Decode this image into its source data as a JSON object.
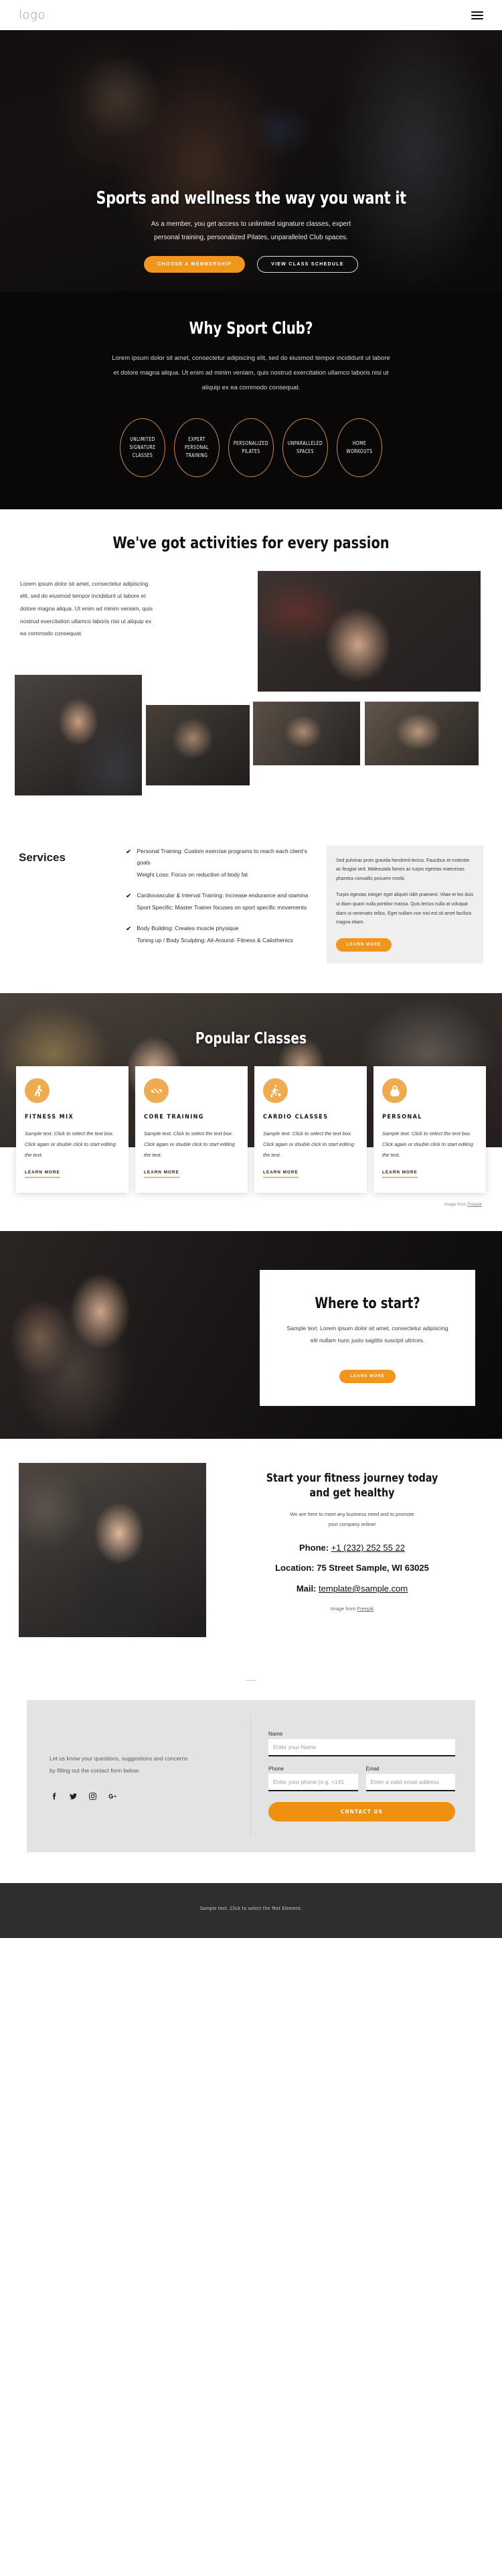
{
  "header": {
    "logo": "logo",
    "menu_icon": "hamburger-icon"
  },
  "hero": {
    "title": "Sports and wellness the way you want it",
    "subtitle_line1": "As a member, you get access to unlimited signature classes, expert",
    "subtitle_line2": "personal training, personalized Pilates, unparalleled Club spaces.",
    "primary_button": "Choose a Membership",
    "secondary_button": "View Class Schedule"
  },
  "why": {
    "title": "Why Sport Club?",
    "paragraph": "Lorem ipsum dolor sit amet, consectetur adipiscing elit, sed do eiusmod tempor incididunt ut labore et dolore magna aliqua. Ut enim ad minim veniam, quis nostrud exercitation ullamco laboris nisi ut aliquip ex ea commodo consequat.",
    "badges": [
      "Unlimited Signature Classes",
      "Expert Personal Training",
      "Personalized Pilates",
      "Unparalleled Spaces",
      "Home Workouts"
    ]
  },
  "activities": {
    "title": "We've got activities for every passion",
    "paragraph": "Lorem ipsum dolor sit amet, consectetur adipiscing elit, sed do eiusmod tempor incididunt ut labore et dolore magna aliqua. Ut enim ad minim veniam, quis nostrud exercitation ullamco laboris nisi ut aliquip ex ea commodo consequat."
  },
  "services": {
    "title": "Services",
    "items": [
      "Personal Training: Custom exercise programs to reach each client’s goals\nWeight Loss: Focus on reduction of body fat",
      "Cardiovascular & Interval Training: Increase endurance and stamina\nSport Specific: Master Trainer focuses on sport specific movements",
      "Body Building: Creates muscle physique\nToning up / Body Sculpting: All-Around- Fitness & Calisthenics"
    ],
    "aside_p1": "Sed pulvinar proin gravida hendrerit lectus. Faucibus et molestie ac feugiat sed. Malesuada fames ac turpis egestas maecenas pharetra convallis posuere morbi.",
    "aside_p2": "Turpis egestas integer eget aliquet nibh praesent. Vitae et leo duis ut diam quam nulla porttitor massa. Quis lectus nulla at volutpat diam ut venenatis tellus. Eget nullam non nisi est sit amet facilisis magna etiam.",
    "aside_button": "Learn More"
  },
  "popular": {
    "title": "Popular Classes",
    "cards": [
      {
        "icon": "stretching-icon",
        "title": "Fitness Mix",
        "text": "Sample text. Click to select the text box. Click again or double click to start editing the text.",
        "link": "Learn More"
      },
      {
        "icon": "dumbbell-icon",
        "title": "Core Training",
        "text": "Sample text. Click to select the text box. Click again or double click to start editing the text.",
        "link": "Learn More"
      },
      {
        "icon": "exercise-bike-icon",
        "title": "Cardio Classes",
        "text": "Sample text. Click to select the text box. Click again or double click to start editing the text.",
        "link": "Learn More"
      },
      {
        "icon": "kettlebell-icon",
        "title": "Personal",
        "text": "Sample text. Click to select the text box. Click again or double click to start editing the text.",
        "link": "Learn More"
      }
    ],
    "credit_prefix": "Image from ",
    "credit_link": "Freepik"
  },
  "where": {
    "title": "Where to start?",
    "text": "Sample text. Lorem ipsum dolor sit amet, consectetur adipiscing elit nullam nunc justo sagittis suscipit ultrices.",
    "button": "Learn More"
  },
  "journey": {
    "title_line1": "Start your fitness journey today",
    "title_line2": "and get healthy",
    "sub_line1": "We are here to meet any business need and to promote",
    "sub_line2": "your company online!",
    "phone_label": "Phone: ",
    "phone_value": "+1 (232) 252 55 22",
    "location_label": "Location: ",
    "location_value": "75 Street Sample, WI 63025",
    "mail_label": "Mail: ",
    "mail_value": "template@sample.com",
    "credit_prefix": "Image from ",
    "credit_link": "Freepik"
  },
  "contact": {
    "blurb_line1": "Let us know your questions, suggestions and concerns",
    "blurb_line2": "by filling out the contact form below.",
    "socials": [
      "facebook-icon",
      "twitter-icon",
      "instagram-icon",
      "google-plus-icon"
    ],
    "name_label": "Name",
    "name_placeholder": "Enter your Name",
    "name_value": "",
    "phone_label": "Phone",
    "phone_placeholder": "Enter your phone (e.g. +141",
    "phone_value": "",
    "email_label": "Email",
    "email_placeholder": "Enter a valid email address",
    "email_value": "",
    "submit": "Contact Us"
  },
  "footer": {
    "text": "Sample text. Click to select the Text Element."
  },
  "colors": {
    "accent": "#f0951d",
    "accent_light": "#eeab4f",
    "dark": "#0a0708",
    "footer": "#2e2e2e"
  }
}
